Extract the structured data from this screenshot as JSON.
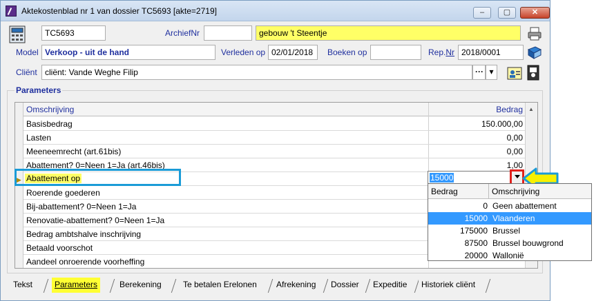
{
  "window": {
    "title": "Aktekostenblad nr 1 van dossier TC5693 [akte=2719]",
    "buttons": {
      "minimize": "–",
      "maximize": "▢",
      "close": "✕"
    }
  },
  "header": {
    "dossier_code": "TC5693",
    "archief_label": "ArchiefNr",
    "archief_value": "",
    "description": "gebouw 't Steentje",
    "model_label": "Model",
    "model_value": "Verkoop - uit de hand",
    "verleden_label": "Verleden op",
    "verleden_value": "02/01/2018",
    "boeken_label": "Boeken op",
    "boeken_value": "",
    "rep_label_a": "Rep.",
    "rep_label_b": "Nr",
    "rep_value": "2018/0001",
    "client_label": "Cliënt",
    "client_value": "cliënt: Vande Weghe Filip",
    "client_more": "···",
    "client_dropdown": "▾"
  },
  "parameters": {
    "legend": "Parameters",
    "columns": {
      "desc": "Omschrijving",
      "amount": "Bedrag"
    },
    "rows": [
      {
        "desc": "Basisbedrag",
        "amount": "150.000,00"
      },
      {
        "desc": "Lasten",
        "amount": "0,00"
      },
      {
        "desc": "Meeneemrecht (art.61bis)",
        "amount": "0,00"
      },
      {
        "desc": "Abattement? 0=Neen 1=Ja (art.46bis)",
        "amount": "1,00"
      },
      {
        "desc": "Abattement op",
        "amount": "15000"
      },
      {
        "desc": "Roerende goederen",
        "amount": ""
      },
      {
        "desc": "Bij-abattement? 0=Neen 1=Ja",
        "amount": ""
      },
      {
        "desc": "Renovatie-abattement? 0=Neen 1=Ja",
        "amount": ""
      },
      {
        "desc": "Bedrag ambtshalve inschrijving",
        "amount": ""
      },
      {
        "desc": "Betaald voorschot",
        "amount": ""
      },
      {
        "desc": "Aandeel onroerende voorheffing",
        "amount": ""
      }
    ]
  },
  "dropdown": {
    "columns": {
      "amount": "Bedrag",
      "desc": "Omschrijving"
    },
    "options": [
      {
        "amount": "0",
        "desc": "Geen abattement"
      },
      {
        "amount": "15000",
        "desc": "Vlaanderen"
      },
      {
        "amount": "175000",
        "desc": "Brussel"
      },
      {
        "amount": "87500",
        "desc": "Brussel bouwgrond"
      },
      {
        "amount": "20000",
        "desc": "Wallonië"
      }
    ],
    "selected_index": 1
  },
  "tabs": [
    {
      "label": "Tekst"
    },
    {
      "label": "Parameters"
    },
    {
      "label": "Berekening"
    },
    {
      "label": "Te betalen Erelonen"
    },
    {
      "label": "Afrekening"
    },
    {
      "label": "Dossier"
    },
    {
      "label": "Expeditie"
    },
    {
      "label": "Historiek cliënt"
    }
  ],
  "colors": {
    "highlight_yellow": "#ffff66",
    "label_blue": "#1f2f9e",
    "selection_blue": "#3399ff",
    "annotation_box": "#1a9bd7",
    "annotation_red": "#e0201c",
    "annotation_arrow": "#f7f000"
  }
}
